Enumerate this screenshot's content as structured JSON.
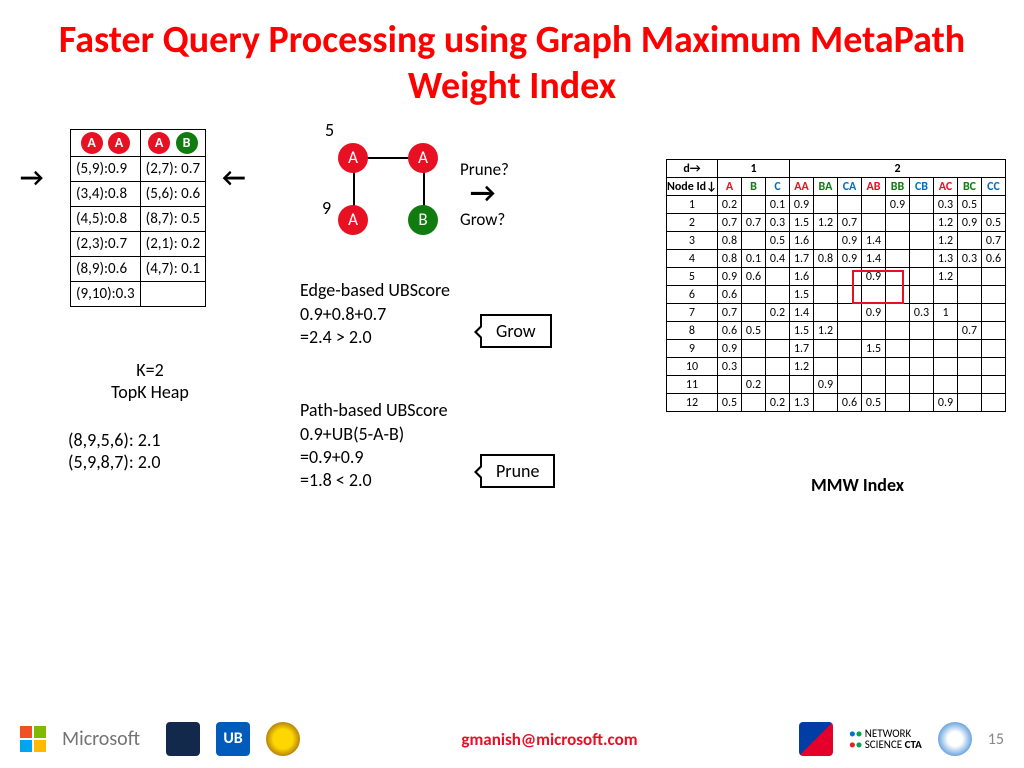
{
  "title": "Faster Query Processing using Graph Maximum MetaPath Weight Index",
  "heap": {
    "headers": [
      [
        "A",
        "A"
      ],
      [
        "A",
        "B"
      ]
    ],
    "rows": [
      [
        "(5,9):0.9",
        "(2,7): 0.7"
      ],
      [
        "(3,4):0.8",
        "(5,6): 0.6"
      ],
      [
        "(4,5):0.8",
        "(8,7): 0.5"
      ],
      [
        "(2,3):0.7",
        "(2,1): 0.2"
      ],
      [
        "(8,9):0.6",
        "(4,7): 0.1"
      ],
      [
        "(9,10):0.3",
        ""
      ]
    ]
  },
  "k_text_1": "K=2",
  "k_text_2": "TopK Heap",
  "topk_1": "(8,9,5,6): 2.1",
  "topk_2": "(5,9,8,7): 2.0",
  "graph": {
    "lab5": "5",
    "lab9": "9",
    "nA1": "A",
    "nA2": "A",
    "nA3": "A",
    "nB": "B",
    "prune": "Prune?",
    "grow": "Grow?"
  },
  "edge_ub_l1": "Edge-based UBScore",
  "edge_ub_l2": "0.9+0.8+0.7",
  "edge_ub_l3": "=2.4 > 2.0",
  "grow_label": "Grow",
  "path_ub_l1": "Path-based UBScore",
  "path_ub_l2": "0.9+UB(5-A-B)",
  "path_ub_l3": "=0.9+0.9",
  "path_ub_l4": "=1.8 < 2.0",
  "prune_label": "Prune",
  "mmw_label": "MMW Index",
  "mmw": {
    "d_arrow": "d→",
    "group1": "1",
    "group2": "2",
    "node_hdr": "Node Id↓",
    "cols": [
      "A",
      "B",
      "C",
      "AA",
      "BA",
      "CA",
      "AB",
      "BB",
      "CB",
      "AC",
      "BC",
      "CC"
    ],
    "col_classes": [
      "col-a",
      "col-b",
      "col-c",
      "col-a",
      "col-b",
      "col-c",
      "col-a",
      "col-b",
      "col-c",
      "col-a",
      "col-b",
      "col-c"
    ],
    "rows": [
      {
        "id": "1",
        "v": [
          "0.2",
          "",
          "0.1",
          "0.9",
          "",
          "",
          "",
          "0.9",
          "",
          "0.3",
          "0.5",
          ""
        ]
      },
      {
        "id": "2",
        "v": [
          "0.7",
          "0.7",
          "0.3",
          "1.5",
          "1.2",
          "0.7",
          "",
          "",
          "",
          "1.2",
          "0.9",
          "0.5"
        ]
      },
      {
        "id": "3",
        "v": [
          "0.8",
          "",
          "0.5",
          "1.6",
          "",
          "0.9",
          "1.4",
          "",
          "",
          "1.2",
          "",
          "0.7"
        ]
      },
      {
        "id": "4",
        "v": [
          "0.8",
          "0.1",
          "0.4",
          "1.7",
          "0.8",
          "0.9",
          "1.4",
          "",
          "",
          "1.3",
          "0.3",
          "0.6"
        ]
      },
      {
        "id": "5",
        "v": [
          "0.9",
          "0.6",
          "",
          "1.6",
          "",
          "",
          "0.9",
          "",
          "",
          "1.2",
          "",
          ""
        ]
      },
      {
        "id": "6",
        "v": [
          "0.6",
          "",
          "",
          "1.5",
          "",
          "",
          "",
          "",
          "",
          "",
          "",
          ""
        ]
      },
      {
        "id": "7",
        "v": [
          "0.7",
          "",
          "0.2",
          "1.4",
          "",
          "",
          "0.9",
          "",
          "0.3",
          "1",
          "",
          ""
        ]
      },
      {
        "id": "8",
        "v": [
          "0.6",
          "0.5",
          "",
          "1.5",
          "1.2",
          "",
          "",
          "",
          "",
          "",
          "0.7",
          ""
        ]
      },
      {
        "id": "9",
        "v": [
          "0.9",
          "",
          "",
          "1.7",
          "",
          "",
          "1.5",
          "",
          "",
          "",
          "",
          ""
        ]
      },
      {
        "id": "10",
        "v": [
          "0.3",
          "",
          "",
          "1.2",
          "",
          "",
          "",
          "",
          "",
          "",
          "",
          ""
        ]
      },
      {
        "id": "11",
        "v": [
          "",
          "0.2",
          "",
          "",
          "0.9",
          "",
          "",
          "",
          "",
          "",
          "",
          ""
        ]
      },
      {
        "id": "12",
        "v": [
          "0.5",
          "",
          "0.2",
          "1.3",
          "",
          "0.6",
          "0.5",
          "",
          "",
          "0.9",
          "",
          ""
        ]
      }
    ]
  },
  "footer": {
    "ms": "Microsoft",
    "email": "gmanish@microsoft.com",
    "cta1": "NETWORK",
    "cta2": "SCIENCE",
    "cta3": "CTA",
    "page": "15"
  }
}
